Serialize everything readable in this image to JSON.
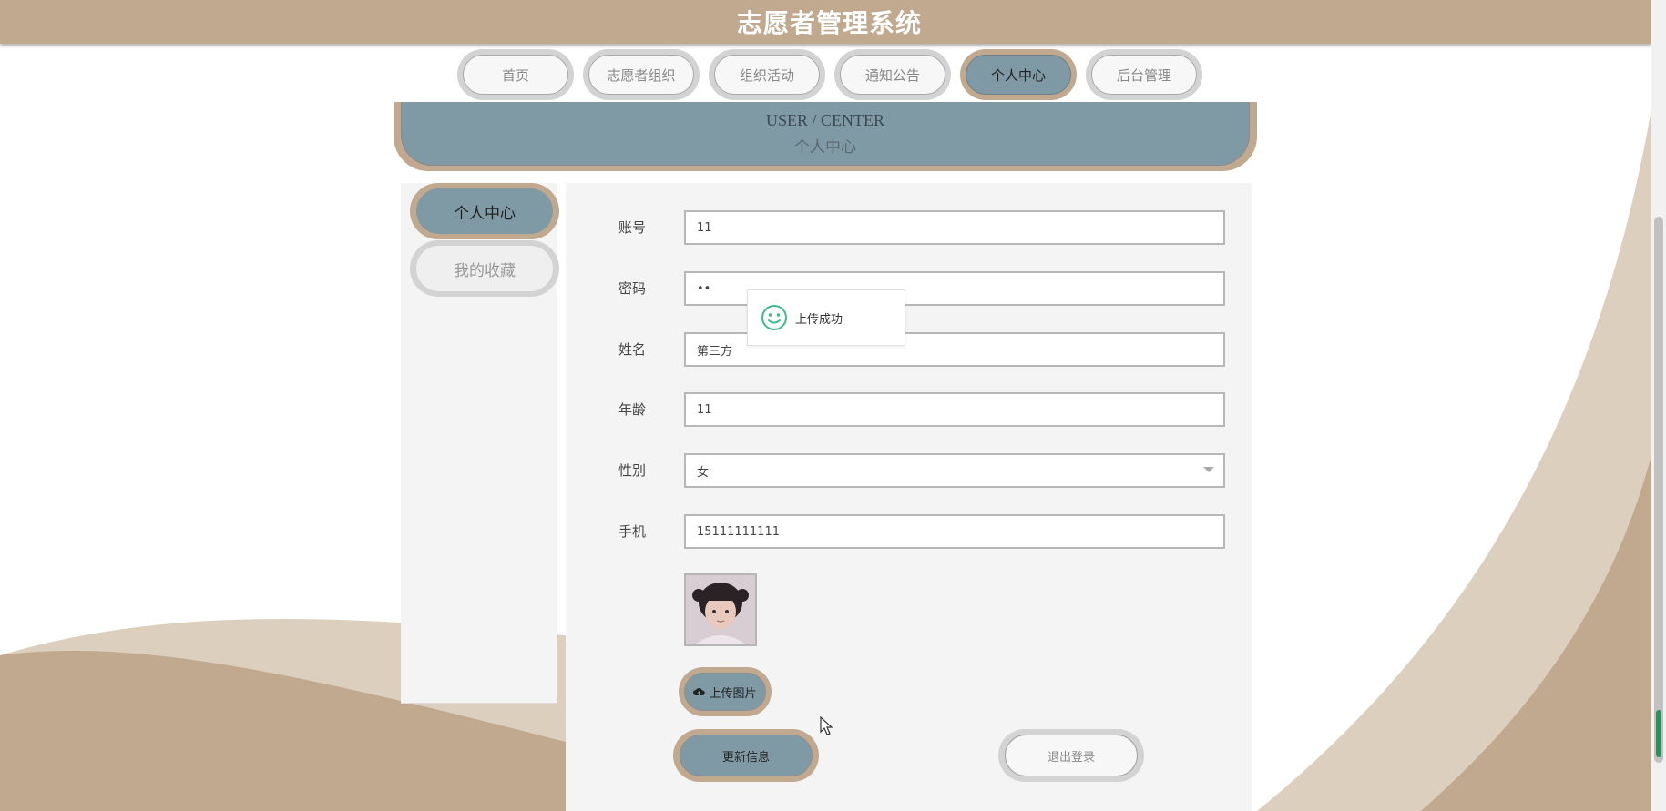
{
  "app": {
    "title": "志愿者管理系统"
  },
  "nav": {
    "items": [
      {
        "label": "首页",
        "active": false
      },
      {
        "label": "志愿者组织",
        "active": false
      },
      {
        "label": "组织活动",
        "active": false
      },
      {
        "label": "通知公告",
        "active": false
      },
      {
        "label": "个人中心",
        "active": true
      },
      {
        "label": "后台管理",
        "active": false
      }
    ]
  },
  "banner": {
    "title_en": "USER / CENTER",
    "title_cn": "个人中心"
  },
  "side_menu": {
    "items": [
      {
        "label": "个人中心",
        "active": true
      },
      {
        "label": "我的收藏",
        "active": false
      }
    ]
  },
  "form": {
    "account": {
      "label": "账号",
      "value": "11"
    },
    "password": {
      "label": "密码",
      "value": "11"
    },
    "name": {
      "label": "姓名",
      "value": "第三方"
    },
    "age": {
      "label": "年龄",
      "value": "11"
    },
    "gender": {
      "label": "性别",
      "value": "女"
    },
    "phone": {
      "label": "手机",
      "value": "15111111111"
    }
  },
  "buttons": {
    "upload_label": "上传图片",
    "update_label": "更新信息",
    "logout_label": "退出登录"
  },
  "toast": {
    "message": "上传成功",
    "icon": "smile-icon"
  },
  "colors": {
    "header": "#c0a98f",
    "accent": "#7f9aa5",
    "inactive": "#d3d3d3",
    "toast_icon": "#3dbb8b"
  }
}
